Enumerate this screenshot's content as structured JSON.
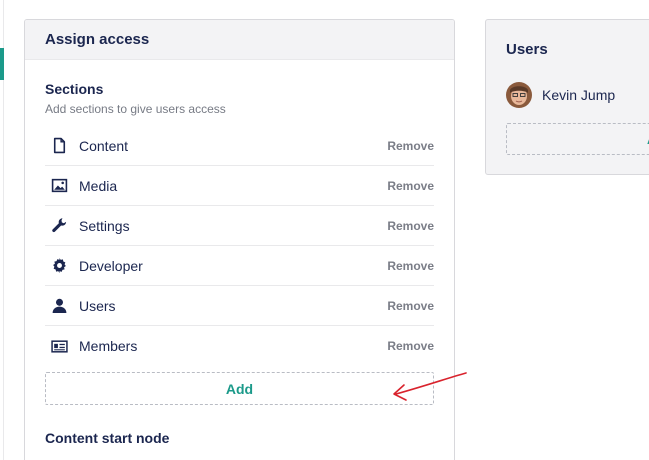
{
  "assign_panel": {
    "title": "Assign access",
    "sections": {
      "title": "Sections",
      "description": "Add sections to give users access",
      "remove_label": "Remove",
      "items": [
        {
          "label": "Content",
          "icon": "document-icon"
        },
        {
          "label": "Media",
          "icon": "image-icon"
        },
        {
          "label": "Settings",
          "icon": "wrench-icon"
        },
        {
          "label": "Developer",
          "icon": "gear-icon"
        },
        {
          "label": "Users",
          "icon": "user-icon"
        },
        {
          "label": "Members",
          "icon": "id-card-icon"
        }
      ],
      "add_label": "Add"
    },
    "content_start_node": {
      "title": "Content start node"
    }
  },
  "users_panel": {
    "title": "Users",
    "users": [
      {
        "name": "Kevin Jump"
      }
    ],
    "add_label": "A"
  },
  "colors": {
    "accent": "#1b9a8a",
    "text": "#1b264f",
    "muted": "#777b85",
    "annotation": "#d9232d"
  }
}
